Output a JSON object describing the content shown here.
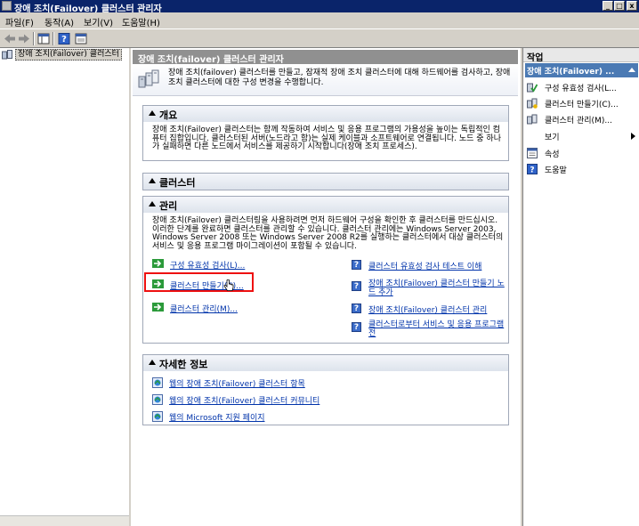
{
  "window": {
    "title": "장애 조치(Failover) 클러스터 관리자",
    "min_glyph": "_",
    "max_glyph": "□",
    "close_glyph": "x"
  },
  "menu": [
    "파일(F)",
    "동작(A)",
    "보기(V)",
    "도움말(H)"
  ],
  "toolbar": {
    "icons": [
      "back-icon",
      "forward-icon",
      "console-tree-icon",
      "help-icon",
      "properties-icon"
    ]
  },
  "tree": {
    "root_label": "장애 조치(Failover) 클러스터"
  },
  "center": {
    "header": "장애 조치(failover) 클러스터 관리자",
    "intro": "장애 조치(failover) 클러스터를 만들고, 잠재적 장애 조치 클러스터에 대해 하드웨어를 검사하고, 장애 조치 클러스터에 대한 구성 변경을 수행합니다.",
    "overview": {
      "title": "개요",
      "text": "장애 조치(Failover) 클러스터는 함께 작동하여 서비스 및 응용 프로그램의 가용성을 높이는 독립적인 컴퓨터 집합입니다. 클러스터된 서버(노드라고 함)는 실제 케이블과 소프트웨어로 연결됩니다. 노드 중 하나가 실패하면 다른 노드에서 서비스를 제공하기 시작합니다(장애 조치 프로세스)."
    },
    "clusters": {
      "title": "클러스터"
    },
    "manage": {
      "title": "관리",
      "text": "장애 조치(Failover) 클러스터링을 사용하려면 먼저 하드웨어 구성을 확인한 후 클러스터를 만드십시오. 이러한 단계를 완료하면 클러스터를 관리할 수 있습니다. 클러스터 관리에는 Windows Server 2003, Windows Server 2008 또는 Windows Server 2008 R2를 실행하는 클러스터에서 대상 클러스터의 서비스 및 응용 프로그램 마이그레이션이 포함될 수 있습니다.",
      "left_links": [
        "구성 유효성 검사(L)...",
        "클러스터 만들기(C)...",
        "클러스터 관리(M)..."
      ],
      "right_links": [
        "클러스터 유효성 검사 테스트 이해",
        "장애 조치(Failover) 클러스터 만들기 노드 추가",
        "장애 조치(Failover) 클러스터 관리",
        "클러스터로부터 서비스 및 응용 프로그램 전"
      ]
    },
    "more_info": {
      "title": "자세한 정보",
      "links": [
        "웹의 장애 조치(Failover) 클러스터 항목",
        "웹의 장애 조치(Failover) 클러스터 커뮤니티",
        "웹의 Microsoft 지원 페이지"
      ]
    }
  },
  "actions": {
    "title": "작업",
    "subheader": "장애 조치(Failover) ...",
    "items": [
      {
        "label": "구성 유효성 검사(L...",
        "icon": "validate-icon"
      },
      {
        "label": "클러스터 만들기(C)...",
        "icon": "create-cluster-icon"
      },
      {
        "label": "클러스터 관리(M)...",
        "icon": "manage-cluster-icon"
      },
      {
        "label": "보기",
        "icon": "none"
      },
      {
        "label": "속성",
        "icon": "properties-icon"
      },
      {
        "label": "도움말",
        "icon": "help-icon"
      }
    ]
  },
  "colors": {
    "title_bar": "#0a246a",
    "link": "#0033aa",
    "highlight": "#ee1111",
    "actions_header": "#4b7ab4"
  }
}
